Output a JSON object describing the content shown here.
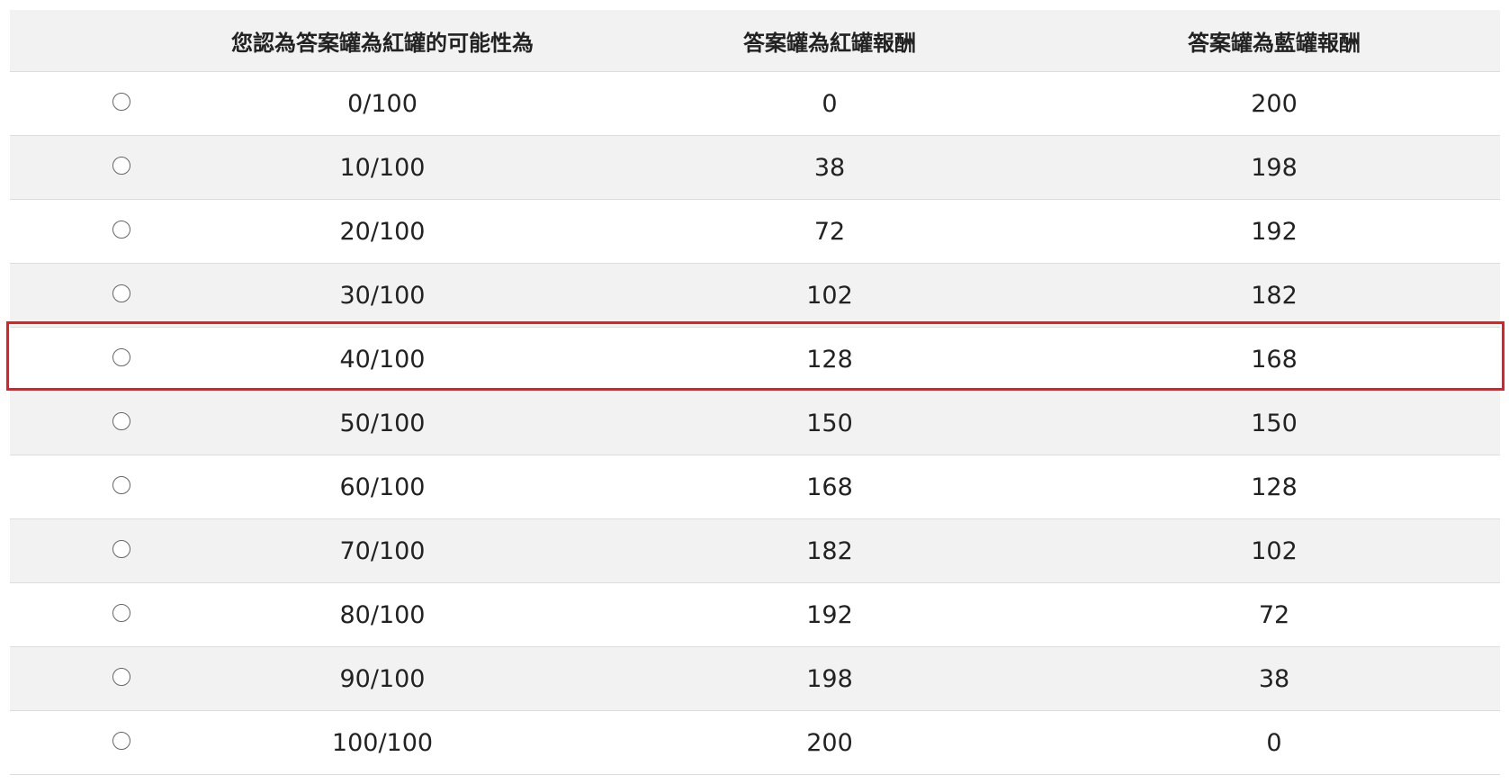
{
  "table": {
    "headers": [
      "",
      "您認為答案罐為紅罐的可能性為",
      "答案罐為紅罐報酬",
      "答案罐為藍罐報酬"
    ],
    "rows": [
      {
        "probability": "0/100",
        "red_payoff": "0",
        "blue_payoff": "200"
      },
      {
        "probability": "10/100",
        "red_payoff": "38",
        "blue_payoff": "198"
      },
      {
        "probability": "20/100",
        "red_payoff": "72",
        "blue_payoff": "192"
      },
      {
        "probability": "30/100",
        "red_payoff": "102",
        "blue_payoff": "182"
      },
      {
        "probability": "40/100",
        "red_payoff": "128",
        "blue_payoff": "168"
      },
      {
        "probability": "50/100",
        "red_payoff": "150",
        "blue_payoff": "150"
      },
      {
        "probability": "60/100",
        "red_payoff": "168",
        "blue_payoff": "128"
      },
      {
        "probability": "70/100",
        "red_payoff": "182",
        "blue_payoff": "102"
      },
      {
        "probability": "80/100",
        "red_payoff": "192",
        "blue_payoff": "72"
      },
      {
        "probability": "90/100",
        "red_payoff": "198",
        "blue_payoff": "38"
      },
      {
        "probability": "100/100",
        "red_payoff": "200",
        "blue_payoff": "0"
      }
    ],
    "highlighted_row": 4,
    "selected_row": null
  },
  "colors": {
    "highlight": "#e81c24",
    "stripe": "#f2f2f2"
  }
}
